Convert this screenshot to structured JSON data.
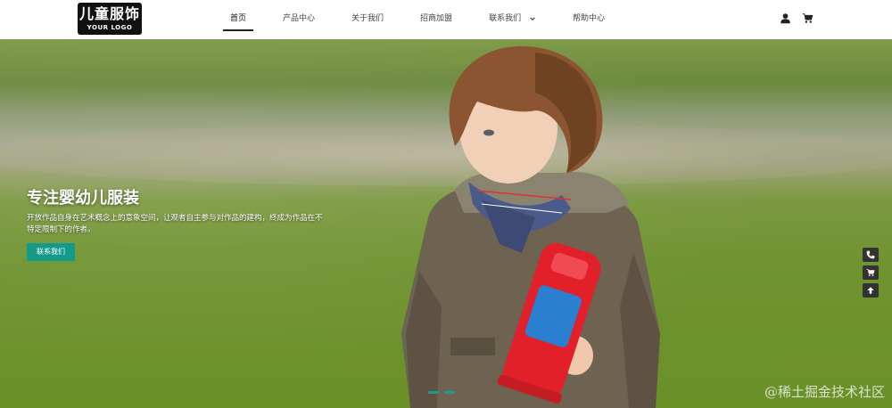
{
  "logo": {
    "title": "儿童服饰",
    "subtitle": "YOUR LOGO"
  },
  "nav": {
    "items": [
      {
        "label": "首页",
        "active": true
      },
      {
        "label": "产品中心"
      },
      {
        "label": "关于我们"
      },
      {
        "label": "招商加盟"
      },
      {
        "label": "联系我们",
        "has_dropdown": true
      },
      {
        "label": "帮助中心"
      }
    ]
  },
  "header_icons": [
    "user-icon",
    "cart-icon"
  ],
  "hero": {
    "title": "专注婴幼儿服装",
    "description": "开放作品自身在艺术概念上的意象空间，让观者自主参与对作品的建构，终成为作品在不特定限制下的作者。",
    "button_label": "联系我们",
    "accent_color": "#139a8b"
  },
  "side_buttons": [
    "phone-icon",
    "cart-icon",
    "arrow-up-icon"
  ],
  "watermark": "@稀土掘金技术社区"
}
